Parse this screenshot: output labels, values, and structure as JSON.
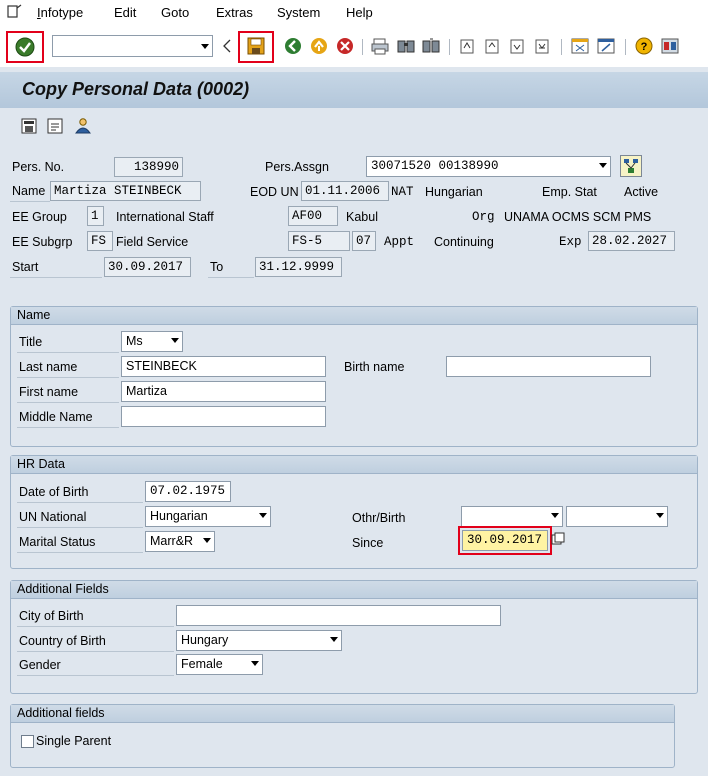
{
  "menu": {
    "items": [
      "Infotype",
      "Edit",
      "Goto",
      "Extras",
      "System",
      "Help"
    ]
  },
  "toolbar": {
    "command_value": ""
  },
  "page": {
    "title": "Copy Personal Data (0002)"
  },
  "header": {
    "pers_no_label": "Pers. No.",
    "pers_no": "138990",
    "pers_assgn_label": "Pers.Assgn",
    "pers_assgn": "30071520 00138990",
    "name_label": "Name",
    "name": "Martiza STEINBECK",
    "eod_label": "EOD UN",
    "eod": "01.11.2006",
    "nat_label": "NAT",
    "nat": "Hungarian",
    "emp_stat_label": "Emp. Stat",
    "emp_stat": "Active",
    "ee_group_label": "EE Group",
    "ee_group_code": "1",
    "ee_group": "International Staff",
    "pa_code": "AF00",
    "pa": "Kabul",
    "org_label": "Org",
    "org": "UNAMA OCMS SCM PMS",
    "ee_subgrp_label": "EE Subgrp",
    "ee_subgrp_code": "FS",
    "ee_subgrp": "Field Service",
    "grade": "FS-5",
    "step": "07",
    "appt_label": "Appt",
    "appt": "Continuing",
    "exp_label": "Exp",
    "exp": "28.02.2027",
    "start_label": "Start",
    "start": "30.09.2017",
    "to_label": "To",
    "to": "31.12.9999"
  },
  "name_group": {
    "title": "Name",
    "title_label": "Title",
    "title_value": "Ms",
    "last_name_label": "Last name",
    "last_name": "STEINBECK",
    "birth_name_label": "Birth name",
    "birth_name": "",
    "first_name_label": "First name",
    "first_name": "Martiza",
    "middle_name_label": "Middle Name",
    "middle_name": ""
  },
  "hr_group": {
    "title": "HR Data",
    "dob_label": "Date of Birth",
    "dob": "07.02.1975",
    "un_national_label": "UN National",
    "un_national": "Hungarian",
    "othr_birth_label": "Othr/Birth",
    "othr_birth_1": "",
    "othr_birth_2": "",
    "marital_label": "Marital Status",
    "marital": "Marr&R",
    "since_label": "Since",
    "since": "30.09.2017"
  },
  "additional_group": {
    "title": "Additional Fields",
    "city_label": "City of Birth",
    "city": "",
    "country_label": "Country of Birth",
    "country": "Hungary",
    "gender_label": "Gender",
    "gender": "Female"
  },
  "additional_fields_2": {
    "title": "Additional fields",
    "single_parent_label": "Single Parent",
    "single_parent": false
  },
  "colors": {
    "highlight": "#e2001a",
    "since_bg": "#fff3a3"
  }
}
